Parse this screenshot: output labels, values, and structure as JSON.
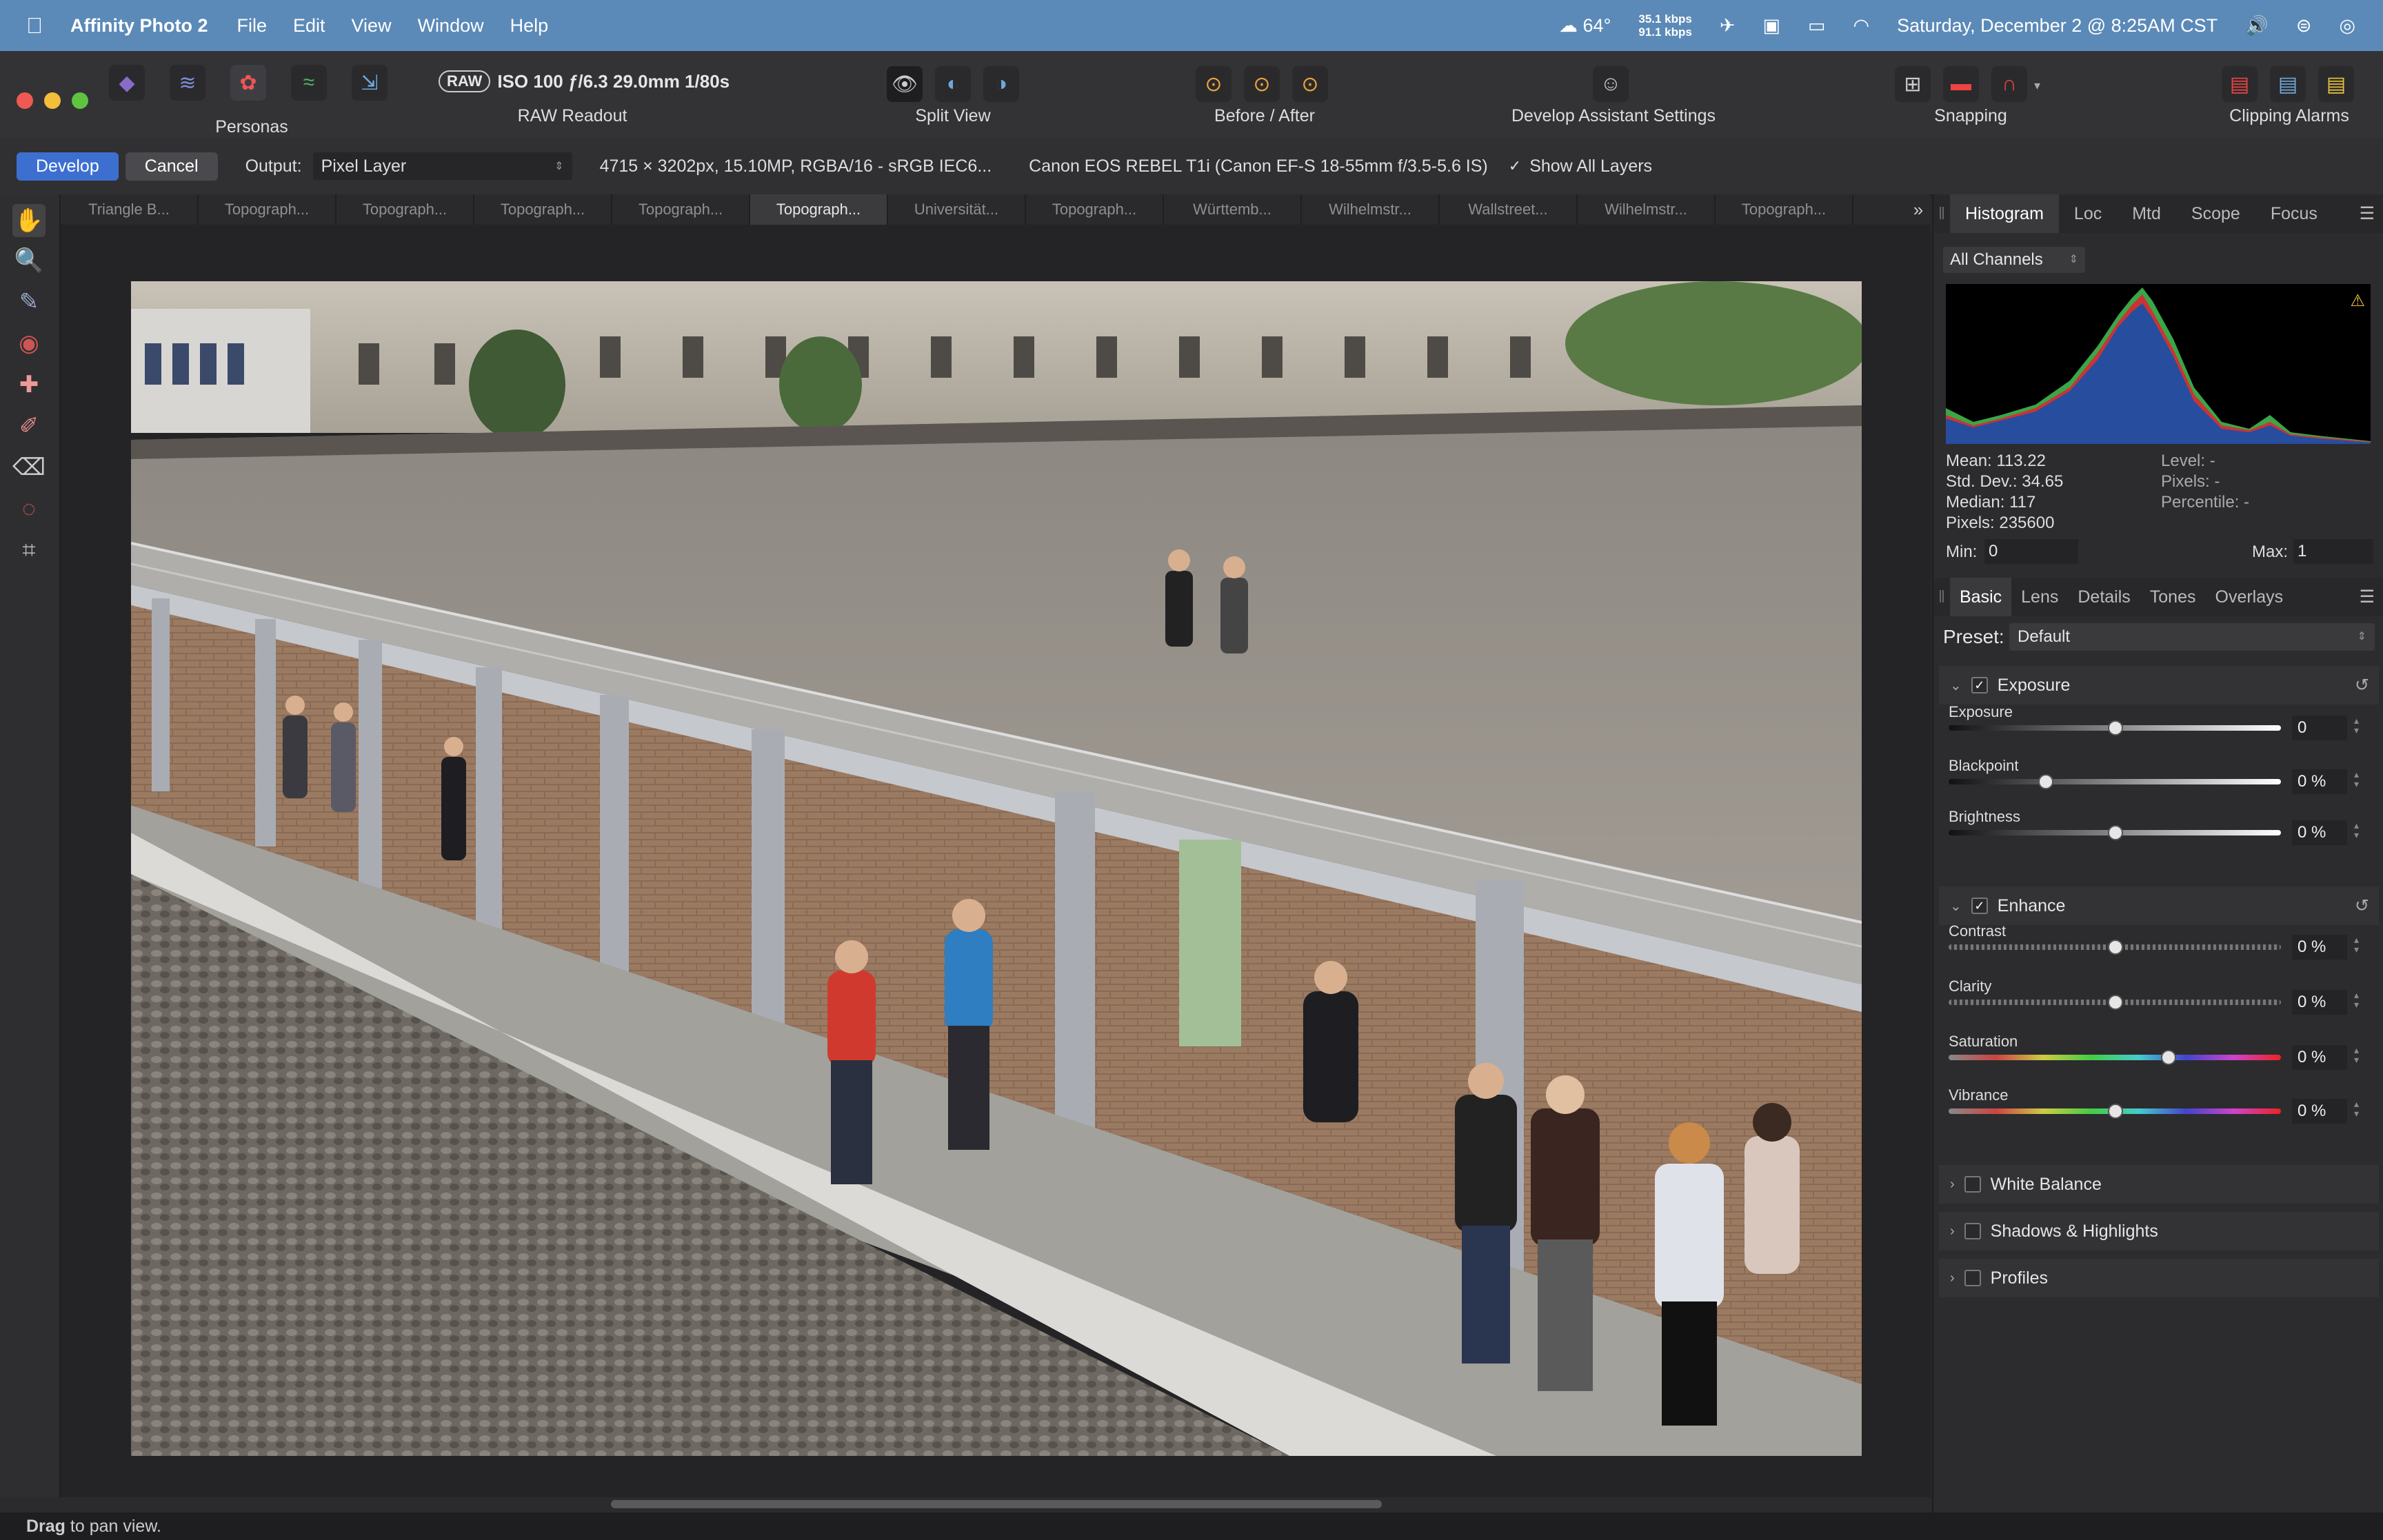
{
  "menubar": {
    "app_name": "Affinity Photo 2",
    "items": [
      "File",
      "Edit",
      "View",
      "Window",
      "Help"
    ],
    "weather": "64°",
    "net_up": "35.1 kbps",
    "net_down": "91.1 kbps",
    "datetime": "Saturday, December 2 @ 8:25AM CST"
  },
  "toolbar": {
    "personas_label": "Personas",
    "raw_badge": "RAW",
    "raw_info": "ISO 100 ƒ/6.3 29.0mm 1/80s",
    "raw_readout_label": "RAW Readout",
    "split_view_label": "Split View",
    "before_after_label": "Before / After",
    "develop_assistant_label": "Develop Assistant Settings",
    "snapping_label": "Snapping",
    "clipping_alarms_label": "Clipping Alarms"
  },
  "context": {
    "develop_label": "Develop",
    "cancel_label": "Cancel",
    "output_label": "Output:",
    "output_value": "Pixel Layer",
    "image_info": "4715 × 3202px, 15.10MP, RGBA/16 - sRGB IEC6...",
    "camera_info": "Canon EOS REBEL T1i (Canon EF-S 18-55mm f/3.5-5.6 IS)",
    "show_all_layers": "Show All Layers"
  },
  "doc_tabs": [
    "Triangle B...",
    "Topograph...",
    "Topograph...",
    "Topograph...",
    "Topograph...",
    "Topograph...",
    "Universität...",
    "Topograph...",
    "Württemb...",
    "Wilhelmstr...",
    "Wallstreet...",
    "Wilhelmstr...",
    "Topograph..."
  ],
  "active_tab_index": 5,
  "histogram_panel": {
    "tabs": [
      "Histogram",
      "Loc",
      "Mtd",
      "Scope",
      "Focus"
    ],
    "channel": "All Channels",
    "mean": "Mean: 113.22",
    "std_dev": "Std. Dev.: 34.65",
    "median": "Median: 117",
    "pixels": "Pixels: 235600",
    "level": "Level: -",
    "pixels_r": "Pixels: -",
    "percentile": "Percentile: -",
    "min_label": "Min:",
    "min_value": "0",
    "max_label": "Max:",
    "max_value": "1"
  },
  "develop_panel": {
    "tabs": [
      "Basic",
      "Lens",
      "Details",
      "Tones",
      "Overlays"
    ],
    "preset_label": "Preset:",
    "preset_value": "Default",
    "exposure_section": "Exposure",
    "enhance_section": "Enhance",
    "sliders": [
      {
        "label": "Exposure",
        "value": "0",
        "pos": 0.5
      },
      {
        "label": "Blackpoint",
        "value": "0 %",
        "pos": 0.29
      },
      {
        "label": "Brightness",
        "value": "0 %",
        "pos": 0.5
      },
      {
        "label": "Contrast",
        "value": "0 %",
        "pos": 0.5
      },
      {
        "label": "Clarity",
        "value": "0 %",
        "pos": 0.5
      },
      {
        "label": "Saturation",
        "value": "0 %",
        "pos": 0.66
      },
      {
        "label": "Vibrance",
        "value": "0 %",
        "pos": 0.5
      }
    ],
    "white_balance": "White Balance",
    "shadows_highlights": "Shadows & Highlights",
    "profiles": "Profiles"
  },
  "status": {
    "bold": "Drag",
    "text": " to pan view."
  }
}
